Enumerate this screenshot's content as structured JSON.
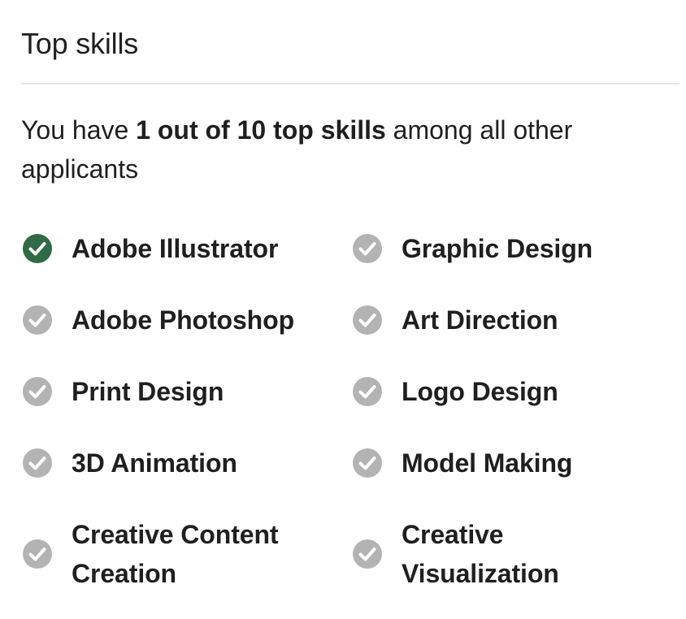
{
  "section": {
    "title": "Top skills"
  },
  "summary": {
    "prefix": "You have ",
    "highlight": "1 out of 10 top skills",
    "suffix": " among all other applicants"
  },
  "colors": {
    "matched": "#2f6b45",
    "unmatched": "#b3b3b3"
  },
  "skills": [
    {
      "label": "Adobe Illustrator",
      "matched": true,
      "icon": "check-circle-icon"
    },
    {
      "label": "Graphic Design",
      "matched": false,
      "icon": "check-circle-icon"
    },
    {
      "label": "Adobe Photoshop",
      "matched": false,
      "icon": "check-circle-icon"
    },
    {
      "label": "Art Direction",
      "matched": false,
      "icon": "check-circle-icon"
    },
    {
      "label": "Print Design",
      "matched": false,
      "icon": "check-circle-icon"
    },
    {
      "label": "Logo Design",
      "matched": false,
      "icon": "check-circle-icon"
    },
    {
      "label": "3D Animation",
      "matched": false,
      "icon": "check-circle-icon"
    },
    {
      "label": "Model Making",
      "matched": false,
      "icon": "check-circle-icon"
    },
    {
      "label": "Creative Content Creation",
      "matched": false,
      "icon": "check-circle-icon"
    },
    {
      "label": "Creative Visualization",
      "matched": false,
      "icon": "check-circle-icon"
    }
  ]
}
